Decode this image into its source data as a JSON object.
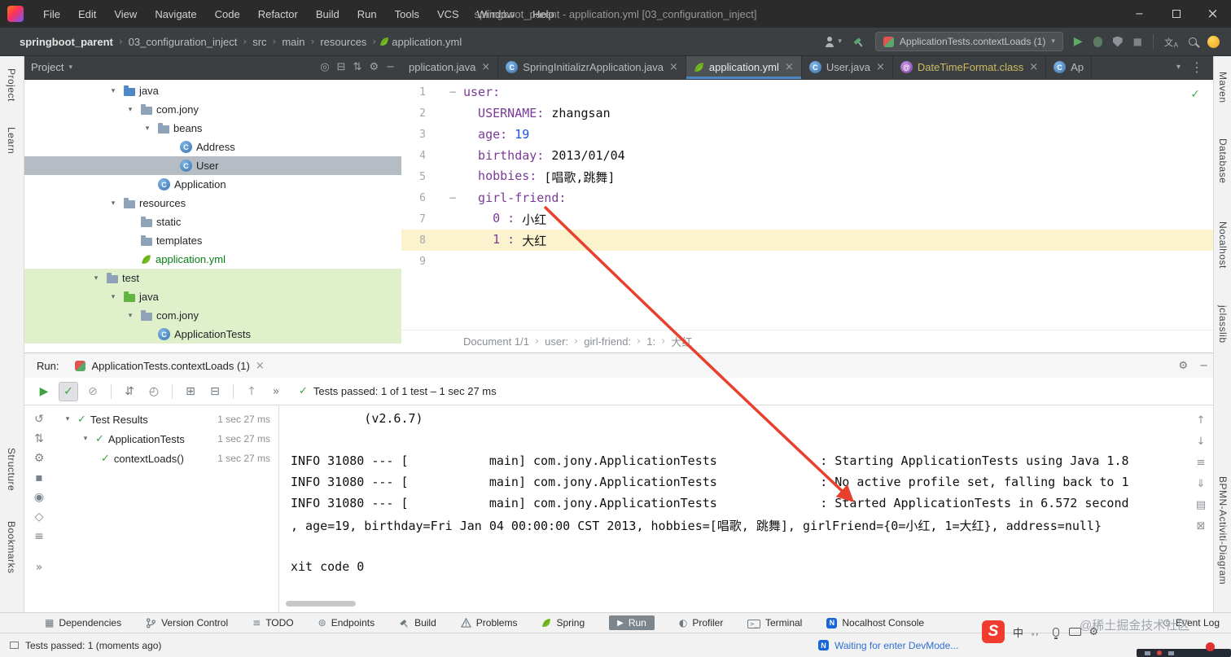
{
  "titlebar": {
    "menus": [
      "File",
      "Edit",
      "View",
      "Navigate",
      "Code",
      "Refactor",
      "Build",
      "Run",
      "Tools",
      "VCS",
      "Window",
      "Help"
    ],
    "title": "springboot_parent - application.yml [03_configuration_inject]"
  },
  "navbar": {
    "crumbs": [
      "springboot_parent",
      "03_configuration_inject",
      "src",
      "main",
      "resources",
      "application.yml"
    ],
    "run_config": "ApplicationTests.contextLoads (1)"
  },
  "strips": {
    "left_top": [
      "Project",
      "Learn"
    ],
    "left_bottom": [
      "Structure",
      "Bookmarks"
    ],
    "right": [
      "Maven",
      "Database",
      "Nocalhost",
      "jclasslib",
      "BPMN-Activiti-Diagram"
    ]
  },
  "project": {
    "title": "Project",
    "tree": [
      {
        "label": "java"
      },
      {
        "label": "com.jony"
      },
      {
        "label": "beans"
      },
      {
        "label": "Address"
      },
      {
        "label": "User"
      },
      {
        "label": "Application"
      },
      {
        "label": "resources"
      },
      {
        "label": "static"
      },
      {
        "label": "templates"
      },
      {
        "label": "application.yml"
      },
      {
        "label": "test"
      },
      {
        "label": "java"
      },
      {
        "label": "com.jony"
      },
      {
        "label": "ApplicationTests"
      }
    ]
  },
  "tabs": [
    {
      "label": "pplication.java"
    },
    {
      "label": "SpringInitializrApplication.java"
    },
    {
      "label": "application.yml"
    },
    {
      "label": "User.java"
    },
    {
      "label": "DateTimeFormat.class"
    },
    {
      "label": "Ap"
    }
  ],
  "editor": {
    "lines": [
      {
        "num": "1",
        "key": "user:"
      },
      {
        "num": "2",
        "key": "  USERNAME:",
        "val": " zhangsan"
      },
      {
        "num": "3",
        "key": "  age:",
        "numval": " 19"
      },
      {
        "num": "4",
        "key": "  birthday:",
        "val": " 2013/01/04"
      },
      {
        "num": "5",
        "key": "  hobbies:",
        "val": " [唱歌,跳舞]"
      },
      {
        "num": "6",
        "key": "  girl-friend:"
      },
      {
        "num": "7",
        "key": "    0 :",
        "val": " 小红"
      },
      {
        "num": "8",
        "key": "    1 :",
        "val": " 大红"
      },
      {
        "num": "9"
      }
    ],
    "breadcrumbs": [
      "Document 1/1",
      "user:",
      "girl-friend:",
      "1:",
      "大红"
    ]
  },
  "run": {
    "label": "Run:",
    "tab": "ApplicationTests.contextLoads (1)",
    "status": "Tests passed: 1 of 1 test – 1 sec 27 ms",
    "tree": [
      {
        "label": "Test Results",
        "time": "1 sec 27 ms"
      },
      {
        "label": "ApplicationTests",
        "time": "1 sec 27 ms"
      },
      {
        "label": "contextLoads()",
        "time": "1 sec 27 ms"
      }
    ],
    "console": [
      "          (v2.6.7)",
      "",
      "INFO 31080 --- [           main] com.jony.ApplicationTests              : Starting ApplicationTests using Java 1.8",
      "INFO 31080 --- [           main] com.jony.ApplicationTests              : No active profile set, falling back to 1",
      "INFO 31080 --- [           main] com.jony.ApplicationTests              : Started ApplicationTests in 6.572 second",
      ", age=19, birthday=Fri Jan 04 00:00:00 CST 2013, hobbies=[唱歌, 跳舞], girlFriend={0=小红, 1=大红}, address=null}",
      "",
      "xit code 0"
    ]
  },
  "bottombar": {
    "items": [
      "Dependencies",
      "Version Control",
      "TODO",
      "Endpoints",
      "Build",
      "Problems",
      "Spring",
      "Run",
      "Profiler",
      "Terminal",
      "Nocalhost Console"
    ],
    "event_log": "Event Log"
  },
  "statusbar": {
    "left": "Tests passed: 1 (moments ago)",
    "right": "Waiting for enter DevMode...",
    "ime_mode": "中",
    "ime_punct": "。，"
  },
  "overlay": {
    "watermark": "@稀土掘金技术社区"
  },
  "colors": {
    "accent_blue": "#4a88c7",
    "run_green": "#59a869",
    "arrow_red": "#e8402c",
    "vcs_green_text": "#067d17",
    "yaml_key": "#7a3a98",
    "yaml_number": "#1750eb"
  }
}
